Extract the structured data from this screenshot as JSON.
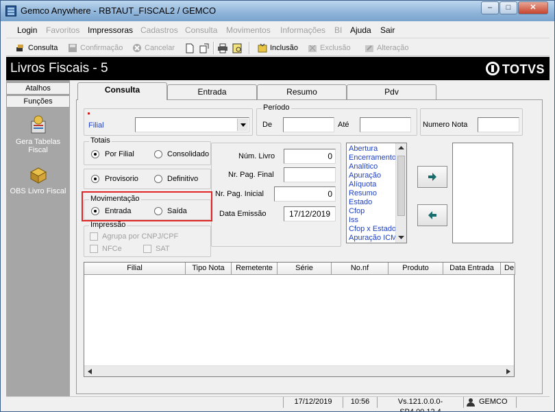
{
  "window": {
    "title": "Gemco Anywhere - RBTAUT_FISCAL2 / GEMCO"
  },
  "menu": [
    "Login",
    "Favoritos",
    "Impressoras",
    "Cadastros",
    "Consulta",
    "Movimentos",
    "Informações",
    "BI",
    "Ajuda",
    "Sair"
  ],
  "toolbar": {
    "consulta": "Consulta",
    "confirmacao": "Confirmação",
    "cancelar": "Cancelar",
    "inclusao": "Inclusão",
    "exclusao": "Exclusão",
    "alteracao": "Alteração"
  },
  "header": {
    "title": "Livros Fiscais  - 5",
    "brand": "TOTVS"
  },
  "sidebar": {
    "tabs": [
      "Atalhos",
      "Funções"
    ],
    "items": [
      "Gera Tabelas Fiscal",
      "OBS Livro Fiscal"
    ]
  },
  "tabs": [
    "Consulta",
    "Entrada",
    "Resumo",
    "Pdv"
  ],
  "form": {
    "filial_label": "Filial",
    "filial_value": "",
    "periodo_label": "Período",
    "de_label": "De",
    "de_value": "",
    "ate_label": "Até",
    "ate_value": "",
    "numero_nota_label": "Numero Nota",
    "numero_nota_value": "",
    "totais_label": "Totais",
    "por_filial": "Por Filial",
    "consolidado": "Consolidado",
    "provisorio": "Provisorio",
    "definitivo": "Definitivo",
    "movimentacao_label": "Movimentação",
    "entrada": "Entrada",
    "saida": "Saída",
    "impressao_label": "Impressão",
    "agrupa": "Agrupa por CNPJ/CPF",
    "nfce": "NFCe",
    "sat": "SAT",
    "num_livro_label": "Núm. Livro",
    "num_livro": "0",
    "nr_pag_final_label": "Nr. Pag. Final",
    "nr_pag_final": "",
    "nr_pag_inicial_label": "Nr. Pag. Inicial",
    "nr_pag_inicial": "0",
    "data_emissao_label": "Data Emissão",
    "data_emissao": "17/12/2019"
  },
  "options_list": [
    "Abertura",
    "Encerramento",
    "Analítico",
    "Apuração",
    "Alíquota",
    "Resumo",
    "Estado",
    "Cfop",
    "Iss",
    "Cfop x Estado",
    "Apuração ICM"
  ],
  "grid_columns": [
    "Filial",
    "Tipo Nota",
    "Remetente",
    "Série",
    "No.nf",
    "Produto",
    "Data Entrada",
    "De"
  ],
  "status": {
    "date": "17/12/2019",
    "time": "10:56",
    "version": "Vs.121.0.0.0-SP4.00.12.4",
    "user": "GEMCO"
  },
  "colors": {
    "header_bg": "#000000",
    "accent_list": "#1a3ec8",
    "highlight": "#e02424"
  }
}
